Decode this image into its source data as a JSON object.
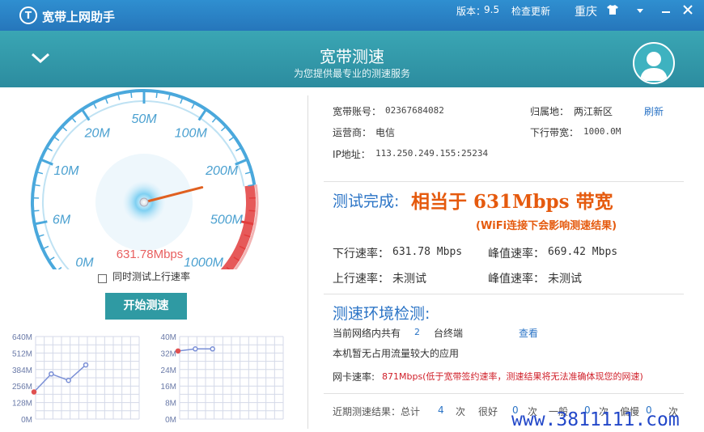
{
  "titlebar": {
    "app_title": "宽带上网助手",
    "logo_letter": "T",
    "version_label": "版本：",
    "version_value": "9.5",
    "update_label": "检查更新",
    "city": "重庆",
    "skin_icon": "shirt-icon",
    "menu_icon": "chevron-down-icon",
    "minimize_icon": "minimize-icon",
    "close_icon": "close-icon"
  },
  "header": {
    "title": "宽带测速",
    "subtitle": "为您提供最专业的测速服务",
    "collapse_icon": "chevron-down-icon",
    "avatar_icon": "user-avatar-icon"
  },
  "gauge": {
    "reading": "631.78Mbps",
    "ticks": [
      "0M",
      "6M",
      "10M",
      "20M",
      "50M",
      "100M",
      "200M",
      "500M",
      "1000M"
    ],
    "value_fraction": 0.78,
    "colors": {
      "scale": "#4aa8dc",
      "danger": "#e23c3c",
      "needle": "#e06020",
      "reading": "#e86060"
    }
  },
  "controls": {
    "upload_test_label": "同时测试上行速率",
    "upload_test_checked": false,
    "start_button": "开始测速"
  },
  "chart_data": [
    {
      "type": "line",
      "ylim": [
        0,
        640
      ],
      "ytick_labels": [
        "640M",
        "512M",
        "384M",
        "256M",
        "128M",
        "0M"
      ],
      "points": [
        210,
        350,
        300,
        420
      ],
      "first_point_color": "#e05050",
      "line_color": "#7a8fd6"
    },
    {
      "type": "line",
      "ylim": [
        0,
        40
      ],
      "ytick_labels": [
        "40M",
        "32M",
        "24M",
        "16M",
        "8M",
        "0M"
      ],
      "points": [
        33,
        34,
        34
      ],
      "first_point_color": "#e05050",
      "line_color": "#7a8fd6"
    }
  ],
  "account": {
    "account_label": "宽带账号：",
    "account_value": "02367684082",
    "location_label": "归属地：",
    "location_value": "两江新区",
    "refresh": "刷新",
    "isp_label": "运营商：",
    "isp_value": "电信",
    "downlink_label": "下行带宽：",
    "downlink_value": "1000.0M",
    "ip_label": "IP地址：",
    "ip_value": "113.250.249.155:25234"
  },
  "result": {
    "head": "测试完成:",
    "summary": "相当于 631Mbps 带宽",
    "wifi_note": "(WiFi连接下会影响测速结果)",
    "down_label": "下行速率：",
    "down_value": "631.78 Mbps",
    "peak_label": "峰值速率：",
    "peak_value": "669.42 Mbps",
    "up_label": "上行速率：",
    "up_value": "未测试",
    "peak_up_label": "峰值速率：",
    "peak_up_value": "未测试"
  },
  "environment": {
    "head": "测速环境检测:",
    "devices_prefix": "当前网络内共有",
    "devices_count": "2",
    "devices_suffix": "台终端",
    "view_link": "查看",
    "app_note": "本机暂无占用流量较大的应用",
    "nic_label": "网卡速率:",
    "nic_value": "871Mbps(低于宽带签约速率，测速结果将无法准确体现您的网速)"
  },
  "recent": {
    "label": "近期测速结果：总计",
    "total": "4",
    "unit1": "次",
    "good_label": "很好",
    "good": "0",
    "unit2": "次",
    "normal_label": "一般",
    "normal": "0",
    "unit3": "次",
    "slow_label": "偏慢",
    "slow": "0",
    "unit4": "次"
  },
  "watermark": "www.3811111.com"
}
